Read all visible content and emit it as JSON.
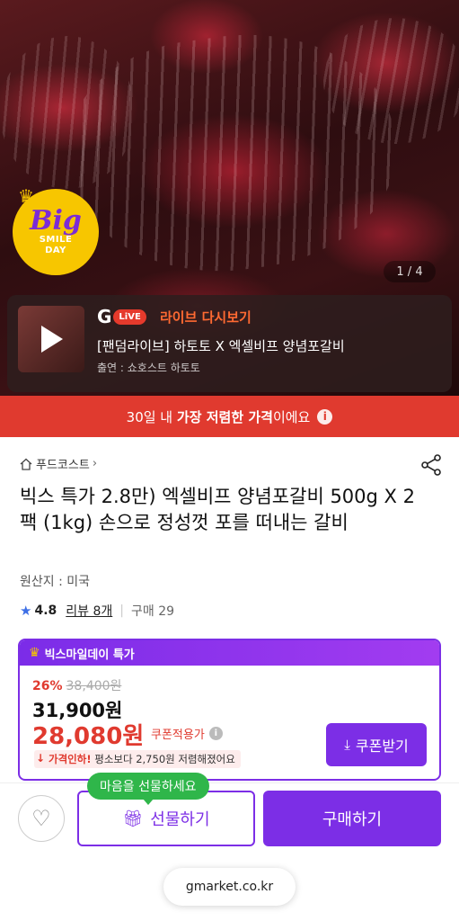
{
  "hero": {
    "pager": "1 / 4",
    "badge": {
      "big": "Big",
      "line1": "SMILE",
      "line2": "DAY"
    }
  },
  "live": {
    "logo_g": "G",
    "logo_live": "LiVE",
    "cta": "라이브 다시보기",
    "title": "[팬덤라이브] 하토토 X 엑셀비프 양념포갈비",
    "host": "출연 : 쇼호스트 하토토"
  },
  "banner": {
    "prefix": "30일 내 ",
    "bold": "가장 저렴한 가격",
    "suffix": "이에요",
    "info_icon": "i"
  },
  "product": {
    "breadcrumb": "푸드코스트",
    "title": "빅스 특가 2.8만) 엑셀비프 양념포갈비 500g X 2팩 (1kg) 손으로 정성껏 포를 떠내는 갈비",
    "origin": "원산지 : 미국",
    "rating": "4.8",
    "review": "리뷰 8개",
    "purchase": "구매 29"
  },
  "promo": {
    "header": "빅스마일데이 특가",
    "discount_pct": "26%",
    "original_price": "38,400원",
    "price": "31,900원",
    "coupon_price": "28,080원",
    "coupon_note": "쿠폰적용가",
    "drop_lead": "가격인하!",
    "drop_text": " 평소보다 2,750원 저렴해졌어요",
    "coupon_button": "쿠폰받기"
  },
  "actions": {
    "tooltip": "마음을 선물하세요",
    "gift": "선물하기",
    "buy": "구매하기",
    "url": "gmarket.co.kr"
  },
  "colors": {
    "accent": "#7c2ee6",
    "red": "#e03a2f",
    "green": "#2fb64a",
    "badge": "#f7c600"
  },
  "icons": [
    "home-icon",
    "share-icon",
    "star-icon",
    "crown-icon",
    "info-icon",
    "play-icon",
    "download-icon",
    "heart-icon",
    "gift-icon"
  ]
}
